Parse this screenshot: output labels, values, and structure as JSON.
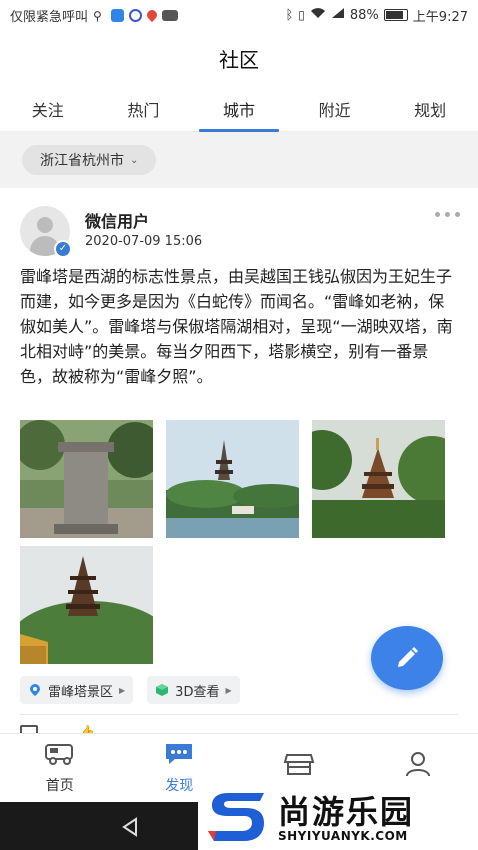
{
  "status_bar": {
    "left_text": "仅限紧急呼叫",
    "battery": "88%",
    "time": "上午9:27"
  },
  "header": {
    "title": "社区"
  },
  "tabs": [
    {
      "label": "关注"
    },
    {
      "label": "热门"
    },
    {
      "label": "城市"
    },
    {
      "label": "附近"
    },
    {
      "label": "规划"
    }
  ],
  "active_tab": "城市",
  "filter": {
    "region": "浙江省杭州市"
  },
  "post": {
    "user_name": "微信用户",
    "time": "2020-07-09 15:06",
    "text": "雷峰塔是西湖的标志性景点，由吴越国王钱弘俶因为王妃生子而建，如今更多是因为《白蛇传》而闻名。“雷峰如老衲，保俶如美人”。雷峰塔与保俶塔隔湖相对，呈现“一湖映双塔，南北相对峙”的美景。每当夕阳西下，塔影横空，别有一番景色，故被称为“雷峰夕照”。",
    "tags": [
      {
        "label": "雷峰塔景区",
        "icon": "location-pin-icon"
      },
      {
        "label": "3D查看",
        "icon": "cube-icon"
      }
    ],
    "photos": [
      {
        "name": "photo-stele"
      },
      {
        "name": "photo-pagoda-lake"
      },
      {
        "name": "photo-pagoda-trees"
      },
      {
        "name": "photo-pagoda-hill"
      }
    ]
  },
  "bottom_nav": [
    {
      "label": "首页",
      "icon": "rv-icon"
    },
    {
      "label": "发现",
      "icon": "chat-bubble-icon"
    },
    {
      "label": "",
      "icon": "store-icon"
    },
    {
      "label": "",
      "icon": "person-icon"
    }
  ],
  "watermark": {
    "brand": "尚游乐园",
    "domain": "SHYIYUANYK.COM"
  },
  "colors": {
    "accent": "#3a7bd5",
    "fab": "#3c82e8",
    "like": "#e04a3a"
  }
}
